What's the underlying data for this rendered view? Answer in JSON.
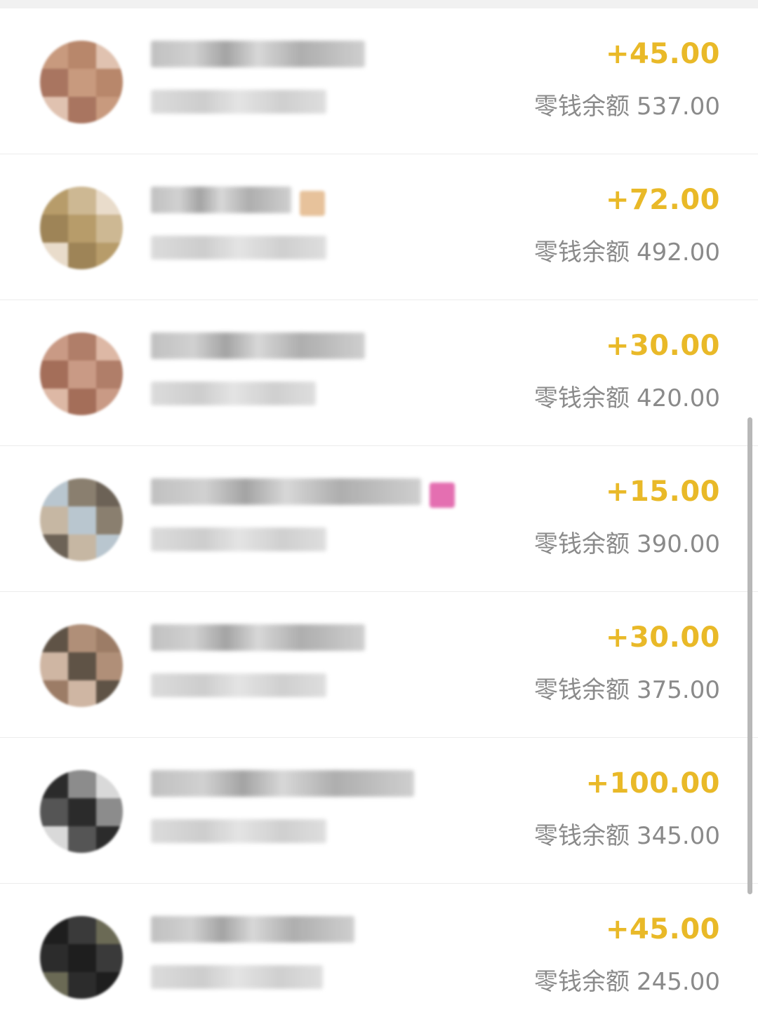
{
  "transactions": [
    {
      "amount": "+45.00",
      "balance_label": "零钱余额",
      "balance": "537.00",
      "avatar_colors": [
        "#c89a7e",
        "#b8876b",
        "#e0c2b0",
        "#a97560"
      ],
      "name_width": 305,
      "sub_width": 250,
      "emoji_color": ""
    },
    {
      "amount": "+72.00",
      "balance_label": "零钱余额",
      "balance": "492.00",
      "avatar_colors": [
        "#b79c6a",
        "#cdb893",
        "#e9dccb",
        "#9e8457"
      ],
      "name_width": 200,
      "sub_width": 250,
      "emoji_color": "#e7c29b"
    },
    {
      "amount": "+30.00",
      "balance_label": "零钱余额",
      "balance": "420.00",
      "avatar_colors": [
        "#c99a85",
        "#b07e69",
        "#ddb8a5",
        "#a46e59"
      ],
      "name_width": 305,
      "sub_width": 235,
      "emoji_color": ""
    },
    {
      "amount": "+15.00",
      "balance_label": "零钱余额",
      "balance": "390.00",
      "avatar_colors": [
        "#b9c6cf",
        "#8a7f6f",
        "#6c6256",
        "#c6b7a3"
      ],
      "name_width": 385,
      "sub_width": 250,
      "emoji_color": "#e46fb1"
    },
    {
      "amount": "+30.00",
      "balance_label": "零钱余额",
      "balance": "375.00",
      "avatar_colors": [
        "#5f5346",
        "#b08f78",
        "#9c7c66",
        "#cfb6a3"
      ],
      "name_width": 305,
      "sub_width": 250,
      "emoji_color": ""
    },
    {
      "amount": "+100.00",
      "balance_label": "零钱余额",
      "balance": "345.00",
      "avatar_colors": [
        "#2b2b2b",
        "#8c8c8c",
        "#d9d9d9",
        "#555555"
      ],
      "name_width": 375,
      "sub_width": 250,
      "emoji_color": ""
    },
    {
      "amount": "+45.00",
      "balance_label": "零钱余额",
      "balance": "245.00",
      "avatar_colors": [
        "#1e1e1e",
        "#3a3a3a",
        "#6b6a55",
        "#2c2c2c"
      ],
      "name_width": 290,
      "sub_width": 245,
      "emoji_color": ""
    }
  ]
}
